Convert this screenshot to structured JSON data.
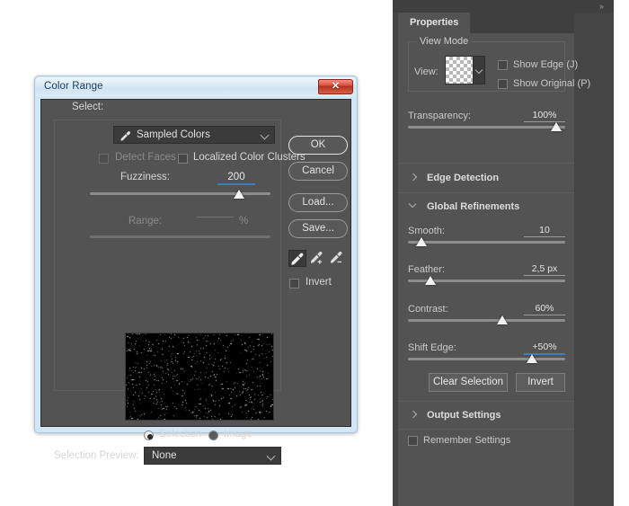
{
  "dialog": {
    "title": "Color Range",
    "close_label": "✕",
    "select_label": "Select:",
    "select_value": "Sampled Colors",
    "select_icon": "eyedropper-icon",
    "detect_faces_label": "Detect Faces",
    "localized_clusters_label": "Localized Color Clusters",
    "fuzziness_label": "Fuzziness:",
    "fuzziness_value": "200",
    "range_label": "Range:",
    "range_value": "",
    "range_unit": "%",
    "preview_mode_selection": "Selection",
    "preview_mode_image": "Image",
    "selection_preview_label": "Selection Preview:",
    "selection_preview_value": "None",
    "buttons": {
      "ok": "OK",
      "cancel": "Cancel",
      "load": "Load...",
      "save": "Save..."
    },
    "eyedroppers": [
      {
        "name": "eyedropper-tool",
        "selected": true
      },
      {
        "name": "eyedropper-add-tool",
        "selected": false
      },
      {
        "name": "eyedropper-subtract-tool",
        "selected": false
      }
    ],
    "invert_label": "Invert"
  },
  "panel": {
    "collapse_icon": "»",
    "tab_label": "Properties",
    "view_mode": {
      "group_title": "View Mode",
      "view_label": "View:",
      "show_edge_label": "Show Edge (J)",
      "show_original_label": "Show Original (P)"
    },
    "transparency": {
      "label": "Transparency:",
      "value": "100%"
    },
    "edge_detection": {
      "title": "Edge Detection",
      "expanded": false
    },
    "global_refinements": {
      "title": "Global Refinements",
      "expanded": true,
      "smooth": {
        "label": "Smooth:",
        "value": "10"
      },
      "feather": {
        "label": "Feather:",
        "value": "2,5 px"
      },
      "contrast": {
        "label": "Contrast:",
        "value": "60%"
      },
      "shift_edge": {
        "label": "Shift Edge:",
        "value": "+50%"
      },
      "clear_selection_label": "Clear Selection",
      "invert_label": "Invert"
    },
    "output_settings": {
      "title": "Output Settings",
      "expanded": false
    },
    "remember_settings_label": "Remember Settings"
  },
  "colors": {
    "accent": "#3b7ec4",
    "panel_bg": "#535353",
    "panel_dark": "#454545",
    "dialog_chrome": "#d3e6f5",
    "close_red": "#d94f3b"
  }
}
